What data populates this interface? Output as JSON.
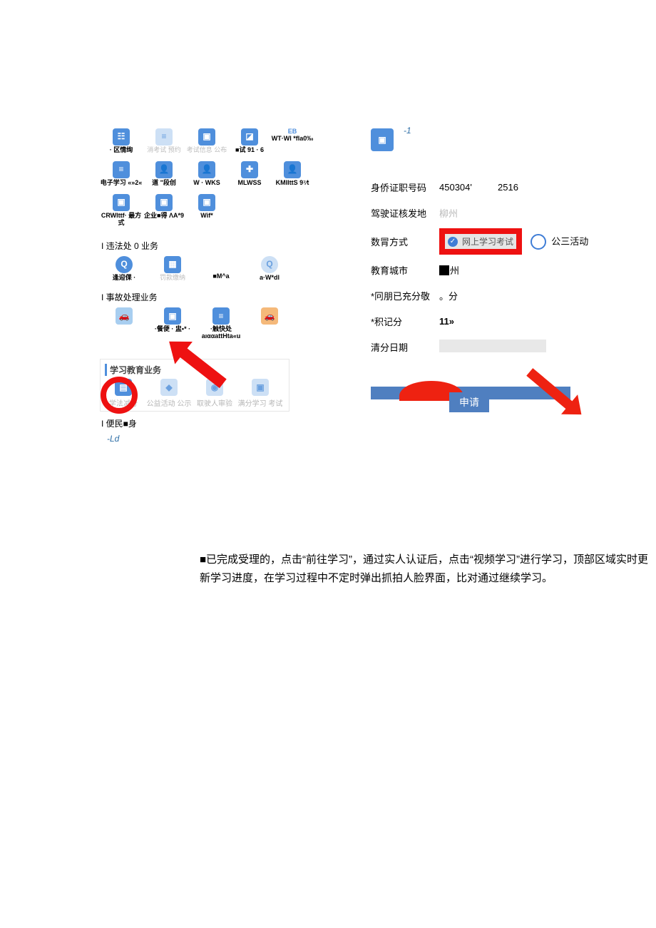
{
  "left": {
    "row1": [
      {
        "label": "· 区情绚",
        "icon": "calendar-icon",
        "style": "ic-blue"
      },
      {
        "label": "消考试 预约",
        "icon": "doc-icon",
        "style": "ic-faint",
        "faint": true
      },
      {
        "label": "考试信息 公布",
        "icon": "bag-icon",
        "style": "ic-blue",
        "faint": true
      },
      {
        "label": "■试 91 · 6",
        "icon": "sheet-icon",
        "style": "ic-blue"
      },
      {
        "top": "EB",
        "label": "WT·WI *fla0‰",
        "textOnly": true
      }
    ],
    "row2": [
      {
        "label": "电子学习 «»2«",
        "icon": "list-icon",
        "style": "ic-blue"
      },
      {
        "label": "道 \"段创",
        "icon": "person-icon",
        "style": "ic-blue"
      },
      {
        "label": "W · WKS",
        "icon": "person-icon",
        "style": "ic-blue"
      },
      {
        "label": "MLWSS",
        "icon": "plus-icon",
        "style": "ic-blue"
      },
      {
        "label": "KMIIttS 9⁷⁄t",
        "icon": "person-icon",
        "style": "ic-blue"
      }
    ],
    "row3": [
      {
        "label": "CRWIttf· 最方式",
        "icon": "cart-icon",
        "style": "ic-blue"
      },
      {
        "label": "企业■得 ΛA*9",
        "icon": "cart-icon",
        "style": "ic-blue"
      },
      {
        "label": "Wif*",
        "icon": "cart-icon",
        "style": "ic-blue"
      }
    ],
    "section2": "I 违法处 0 业务",
    "row4": [
      {
        "label": "逢迎倮 ·",
        "icon": "search-icon",
        "style": "ic-blue ic-circle"
      },
      {
        "label": "罚款缴纳",
        "icon": "grid-icon",
        "style": "ic-blue",
        "faint": true
      },
      {
        "label": "■M^a",
        "textOnly": true
      },
      {
        "label": "a·W*dl",
        "icon": "search-icon",
        "style": "ic-faint ic-circle"
      }
    ],
    "section3": "I 事故处理业务",
    "row5": [
      {
        "label": "",
        "icon": "car-icon",
        "style": "ic-lightblue"
      },
      {
        "label": "·餐便 · 盅•* ·",
        "icon": "box-icon",
        "style": "ic-blue"
      },
      {
        "label": "·触快处 aıααattHta«u",
        "icon": "list-icon",
        "style": "ic-blue"
      },
      {
        "label": "",
        "icon": "car-icon",
        "style": "ic-orange"
      }
    ],
    "study": {
      "head": "学习教育业务",
      "items": [
        {
          "label": "学法减分",
          "icon": "book-icon",
          "style": "ic-blue"
        },
        {
          "label": "公益活动 公示",
          "icon": "badge-icon",
          "style": "ic-faint"
        },
        {
          "label": "取驶人审验",
          "icon": "user-icon",
          "style": "ic-faint"
        },
        {
          "label": "满分学习 考试",
          "icon": "cube-icon",
          "style": "ic-faint"
        }
      ]
    },
    "section5": "I 便民■身",
    "ld": "-Ld"
  },
  "right": {
    "minus1": "-1",
    "form": {
      "id_label": "身侨证职号码",
      "id_a": "450304'",
      "id_b": "2516",
      "issue_label": "驾驶证核发地",
      "issue_val": "柳州",
      "method_label": "数冐方式",
      "method_val": "网上学习考试",
      "method_alt": "公三活动",
      "city_label": "教育城市",
      "city_val": "州",
      "credit_label": "*冋朋已充分敬",
      "credit_val": "。分",
      "score_label": "*积记分",
      "score_val": "11»",
      "date_label": "清分日期"
    },
    "apply": "申请"
  },
  "paragraph": "■已完成受理的，点击“前往学习”，通过实人认证后，点击“视频学习”进行学习，顶部区域实时更新学习进度，在学习过程中不定时弹出抓拍人脸界面，比对通过继续学习。"
}
